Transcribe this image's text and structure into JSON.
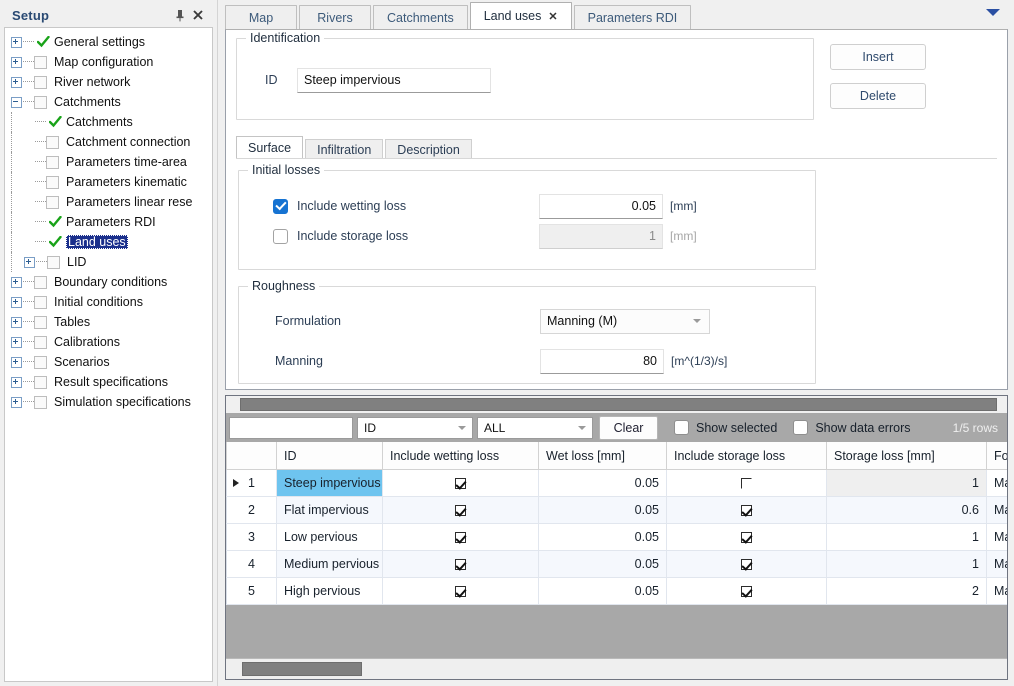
{
  "setup_panel": {
    "title": "Setup",
    "pin_icon": "pin-icon",
    "close_icon": "close-icon",
    "tree": [
      {
        "label": "General settings",
        "depth": 0,
        "expander": "plus",
        "mark": "check"
      },
      {
        "label": "Map configuration",
        "depth": 0,
        "expander": "plus",
        "mark": "box"
      },
      {
        "label": "River network",
        "depth": 0,
        "expander": "plus",
        "mark": "box"
      },
      {
        "label": "Catchments",
        "depth": 0,
        "expander": "minus",
        "mark": "box"
      },
      {
        "label": "Catchments",
        "depth": 1,
        "expander": "none",
        "mark": "check"
      },
      {
        "label": "Catchment connection",
        "depth": 1,
        "expander": "none",
        "mark": "box"
      },
      {
        "label": "Parameters time-area",
        "depth": 1,
        "expander": "none",
        "mark": "box"
      },
      {
        "label": "Parameters kinematic",
        "depth": 1,
        "expander": "none",
        "mark": "box"
      },
      {
        "label": "Parameters linear rese",
        "depth": 1,
        "expander": "none",
        "mark": "box"
      },
      {
        "label": "Parameters RDI",
        "depth": 1,
        "expander": "none",
        "mark": "check"
      },
      {
        "label": "Land uses",
        "depth": 1,
        "expander": "none",
        "mark": "check",
        "selected": true
      },
      {
        "label": "LID",
        "depth": 1,
        "expander": "plus",
        "mark": "box"
      },
      {
        "label": "Boundary conditions",
        "depth": 0,
        "expander": "plus",
        "mark": "box"
      },
      {
        "label": "Initial conditions",
        "depth": 0,
        "expander": "plus",
        "mark": "box"
      },
      {
        "label": "Tables",
        "depth": 0,
        "expander": "plus",
        "mark": "box"
      },
      {
        "label": "Calibrations",
        "depth": 0,
        "expander": "plus",
        "mark": "box"
      },
      {
        "label": "Scenarios",
        "depth": 0,
        "expander": "plus",
        "mark": "box"
      },
      {
        "label": "Result specifications",
        "depth": 0,
        "expander": "plus",
        "mark": "box"
      },
      {
        "label": "Simulation specifications",
        "depth": 0,
        "expander": "plus",
        "mark": "box"
      }
    ]
  },
  "tabs": [
    {
      "label": "Map",
      "active": false,
      "closable": false
    },
    {
      "label": "Rivers",
      "active": false,
      "closable": false
    },
    {
      "label": "Catchments",
      "active": false,
      "closable": false
    },
    {
      "label": "Land uses",
      "active": true,
      "closable": true,
      "close_label": "✕"
    },
    {
      "label": "Parameters RDI",
      "active": false,
      "closable": false
    }
  ],
  "tabstrip_overflow_icon": "chevron-down-icon",
  "identification": {
    "legend": "Identification",
    "id_label": "ID",
    "id_value": "Steep impervious",
    "id_placeholder": ""
  },
  "buttons": {
    "insert": "Insert",
    "delete": "Delete"
  },
  "subtabs": [
    {
      "label": "Surface",
      "active": true
    },
    {
      "label": "Infiltration",
      "active": false
    },
    {
      "label": "Description",
      "active": false
    }
  ],
  "initial_losses": {
    "legend": "Initial losses",
    "wetting": {
      "label": "Include wetting loss",
      "checked": true,
      "value": "0.05",
      "unit": "[mm]"
    },
    "storage": {
      "label": "Include storage loss",
      "checked": false,
      "value": "1",
      "unit": "[mm]"
    }
  },
  "roughness": {
    "legend": "Roughness",
    "formulation": {
      "label": "Formulation",
      "value": "Manning (M)"
    },
    "manning": {
      "label": "Manning",
      "value": "80",
      "unit": "[m^(1/3)/s]"
    }
  },
  "filter_bar": {
    "search_value": "",
    "search_placeholder": "",
    "field_combo": "ID",
    "scope_combo": "ALL",
    "clear_button": "Clear",
    "show_selected": {
      "label": "Show selected",
      "checked": false
    },
    "show_data_errors": {
      "label": "Show data errors",
      "checked": false
    },
    "rows_count": "1/5 rows"
  },
  "table": {
    "columns": [
      "",
      "ID",
      "Include wetting loss",
      "Wet loss [mm]",
      "Include storage loss",
      "Storage loss [mm]",
      "For"
    ],
    "rows": [
      {
        "num": "1",
        "id": "Steep impervious",
        "wetting": true,
        "wet_loss": "0.05",
        "storage": false,
        "storage_loss": "1",
        "formulation": "Man",
        "selected": true
      },
      {
        "num": "2",
        "id": "Flat impervious",
        "wetting": true,
        "wet_loss": "0.05",
        "storage": true,
        "storage_loss": "0.6",
        "formulation": "Man",
        "selected": false
      },
      {
        "num": "3",
        "id": "Low pervious",
        "wetting": true,
        "wet_loss": "0.05",
        "storage": true,
        "storage_loss": "1",
        "formulation": "Man",
        "selected": false
      },
      {
        "num": "4",
        "id": "Medium pervious",
        "wetting": true,
        "wet_loss": "0.05",
        "storage": true,
        "storage_loss": "1",
        "formulation": "Man",
        "selected": false
      },
      {
        "num": "5",
        "id": "High pervious",
        "wetting": true,
        "wet_loss": "0.05",
        "storage": true,
        "storage_loss": "2",
        "formulation": "Man",
        "selected": false
      }
    ]
  },
  "colors": {
    "accent_blue": "#1673d2",
    "selection_blue": "#1a2f8c",
    "row_select": "#6ec4ef",
    "panel_bg": "#f0f0f0",
    "grid_bg": "#a8a8a8"
  }
}
